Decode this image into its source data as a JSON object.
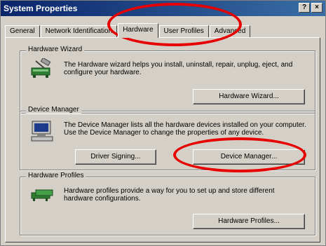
{
  "window": {
    "title": "System Properties",
    "help_button": "?",
    "close_button": "×"
  },
  "tabs": [
    {
      "label": "General",
      "active": false
    },
    {
      "label": "Network Identification",
      "active": false
    },
    {
      "label": "Hardware",
      "active": true
    },
    {
      "label": "User Profiles",
      "active": false
    },
    {
      "label": "Advanced",
      "active": false
    }
  ],
  "hardware_wizard": {
    "legend": "Hardware Wizard",
    "description": "The Hardware wizard helps you install, uninstall, repair, unplug, eject, and configure your hardware.",
    "button": "Hardware Wizard..."
  },
  "device_manager": {
    "legend": "Device Manager",
    "description": "The Device Manager lists all the hardware devices installed on your computer. Use the Device Manager to change the properties of any device.",
    "driver_signing_button": "Driver Signing...",
    "device_manager_button": "Device Manager..."
  },
  "hardware_profiles": {
    "legend": "Hardware Profiles",
    "description": "Hardware profiles provide a way for you to set up and store different hardware configurations.",
    "button": "Hardware Profiles..."
  },
  "colors": {
    "annotation": "#e60000",
    "titlebar": "#0a246a",
    "face": "#d4d0c8"
  }
}
